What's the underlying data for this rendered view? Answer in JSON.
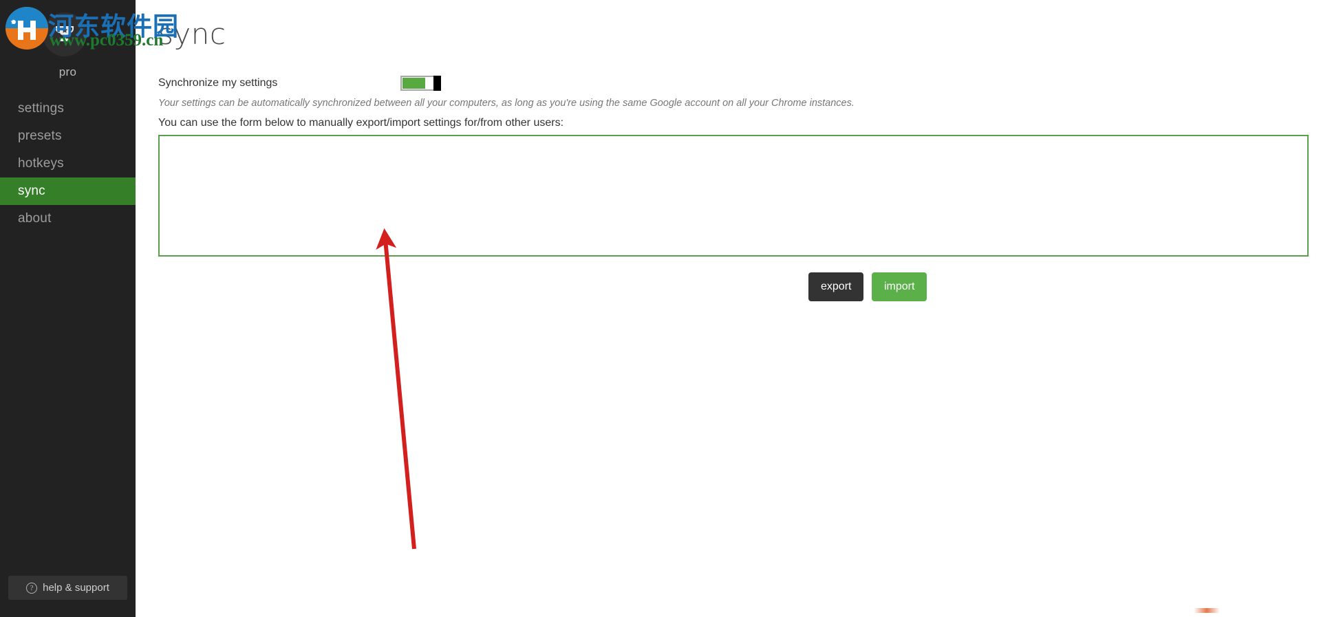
{
  "sidebar": {
    "brand_label": "pro",
    "brand_icon": "trophy-icon",
    "items": [
      {
        "label": "settings",
        "active": false
      },
      {
        "label": "presets",
        "active": false
      },
      {
        "label": "hotkeys",
        "active": false
      },
      {
        "label": "sync",
        "active": true
      },
      {
        "label": "about",
        "active": false
      }
    ],
    "help": {
      "label": "help & support",
      "icon": "question-mark-icon",
      "icon_glyph": "?"
    },
    "colors": {
      "background": "#222222",
      "active_item": "#357f28",
      "item_text": "#9d9d9d",
      "active_item_text": "#ffffff"
    }
  },
  "watermark": {
    "chinese_text": "河东软件园",
    "url_text": "www.pc0359.cn",
    "chinese_color": "#1a6fb5",
    "url_color": "#1d7a2e"
  },
  "main": {
    "page_title": "sync",
    "sync_setting": {
      "label": "Synchronize my settings",
      "toggle_state": "on",
      "toggle_fill_color": "#57aa3f",
      "toggle_thumb_color": "#000000"
    },
    "description": "Your settings can be automatically synchronized between all your computers, as long as you're using the same Google account on all your Chrome instances.",
    "form_hint": "You can use the form below to manually export/import settings for/from other users:",
    "textarea": {
      "value": "",
      "placeholder": "",
      "border_color": "#5aa04a"
    },
    "buttons": {
      "export": {
        "label": "export",
        "color": "#333333"
      },
      "import": {
        "label": "import",
        "color": "#5cb04a"
      }
    }
  },
  "annotation": {
    "arrow_color": "#d41f1f",
    "points_to": "settings-textarea"
  }
}
